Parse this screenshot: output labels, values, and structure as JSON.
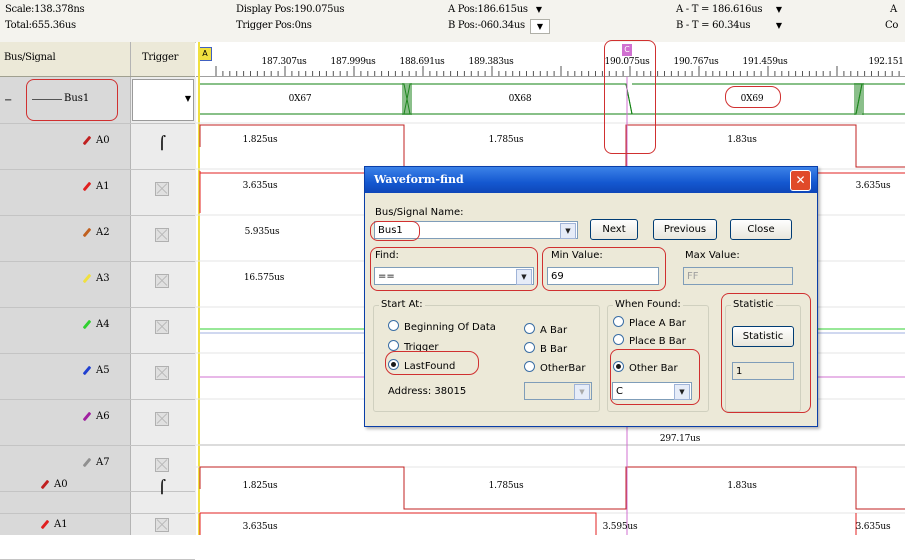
{
  "header": {
    "scale": "Scale:138.378ns",
    "total": "Total:655.36us",
    "display_pos": "Display Pos:190.075us",
    "trigger_pos": "Trigger Pos:0ns",
    "a_pos": "A Pos:186.615us",
    "b_pos": "B Pos:-060.34us",
    "a_minus_t": "A - T = 186.616us",
    "b_minus_t": "B - T = 60.34us",
    "right_a": "A",
    "right_c": "Co"
  },
  "columns": {
    "bus_signal": "Bus/Signal",
    "trigger": "Trigger"
  },
  "ruler": {
    "ticks": [
      "187.307us",
      "187.999us",
      "188.691us",
      "189.383us",
      "190.075us",
      "190.767us",
      "191.459us",
      "192.151"
    ],
    "cursor_label": "C",
    "marker_label": "A"
  },
  "signals": [
    {
      "name": "Bus1",
      "color": "#2a2a2a",
      "trigger": "dropdown"
    },
    {
      "name": "A0",
      "color": "#c02020",
      "trigger": "rising"
    },
    {
      "name": "A1",
      "color": "#e02020",
      "trigger": "none"
    },
    {
      "name": "A2",
      "color": "#c06020",
      "trigger": "none"
    },
    {
      "name": "A3",
      "color": "#f0e040",
      "trigger": "none"
    },
    {
      "name": "A4",
      "color": "#30d030",
      "trigger": "none"
    },
    {
      "name": "A5",
      "color": "#2040d0",
      "trigger": "none"
    },
    {
      "name": "A6",
      "color": "#a020a0",
      "trigger": "none"
    },
    {
      "name": "A7",
      "color": "#909090",
      "trigger": "none"
    },
    {
      "name": "A0",
      "color": "#c02020",
      "trigger": "rising"
    },
    {
      "name": "A1",
      "color": "#e02020",
      "trigger": "none"
    }
  ],
  "waves": {
    "bus": [
      "0X67",
      "0X68",
      "0X69"
    ],
    "a0": [
      "1.825us",
      "1.785us",
      "1.83us"
    ],
    "a1": [
      "3.635us",
      "3.635us"
    ],
    "a2": [
      "5.935us"
    ],
    "a3": [
      "16.575us"
    ],
    "a7": [
      "297.17us"
    ],
    "a0b": [
      "1.825us",
      "1.785us",
      "1.83us"
    ],
    "a1b": [
      "3.635us",
      "3.595us",
      "3.635us"
    ]
  },
  "dialog": {
    "title": "Waveform-find",
    "bus_signal_label": "Bus/Signal Name:",
    "bus_signal_value": "Bus1",
    "next": "Next",
    "previous": "Previous",
    "close": "Close",
    "find_label": "Find:",
    "find_value": "==",
    "min_label": "Min Value:",
    "min_value": "69",
    "max_label": "Max Value:",
    "max_value": "FF",
    "start_at": "Start At:",
    "opt_beginning": "Beginning Of Data",
    "opt_trigger": "Trigger",
    "opt_lastfound": "LastFound",
    "opt_abar": "A Bar",
    "opt_bbar": "B Bar",
    "opt_otherbar_start": "OtherBar",
    "address": "Address: 38015",
    "when_found": "When Found:",
    "opt_place_a": "Place A Bar",
    "opt_place_b": "Place B Bar",
    "opt_other_bar": "Other Bar",
    "other_bar_value": "C",
    "statistic_group": "Statistic",
    "statistic_button": "Statistic",
    "statistic_value": "1"
  },
  "colors": {
    "highlight": "#d03030",
    "title_bar": "#1458d0",
    "cursor_line": "#d070d0"
  }
}
